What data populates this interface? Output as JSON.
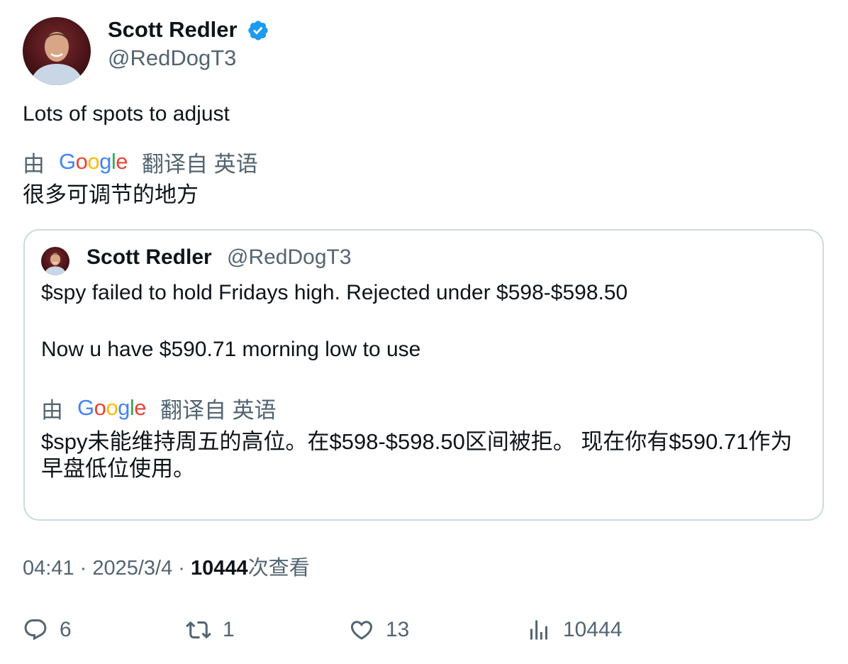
{
  "author": {
    "name": "Scott Redler",
    "handle": "@RedDogT3",
    "verified": true,
    "verified_color": "#1d9bf0"
  },
  "tweet": {
    "text": "Lots of spots to adjust",
    "translation": {
      "by": "由",
      "provider": "Google",
      "from": "翻译自 英语",
      "text": "很多可调节的地方"
    }
  },
  "quote": {
    "name": "Scott Redler",
    "handle": "@RedDogT3",
    "line1": "$spy failed to hold Fridays high.  Rejected under $598-$598.50",
    "line2": "Now u have $590.71 morning low to use",
    "translation": {
      "by": "由",
      "provider": "Google",
      "from": "翻译自 英语",
      "text": "$spy未能维持周五的高位。在$598-$598.50区间被拒。 现在你有$590.71作为早盘低位使用。"
    }
  },
  "meta": {
    "time": "04:41",
    "sep1": " · ",
    "date": "2025/3/4",
    "sep2": " · ",
    "views": "10444",
    "views_suffix": "次查看"
  },
  "actions": {
    "replies": "6",
    "retweets": "1",
    "likes": "13",
    "views": "10444"
  },
  "colors": {
    "text": "#0f1419",
    "secondary": "#536471",
    "border": "#cfd9de",
    "google_blue": "#4285f4",
    "google_red": "#ea4335",
    "google_yellow": "#fbbc05",
    "google_green": "#34a853"
  }
}
